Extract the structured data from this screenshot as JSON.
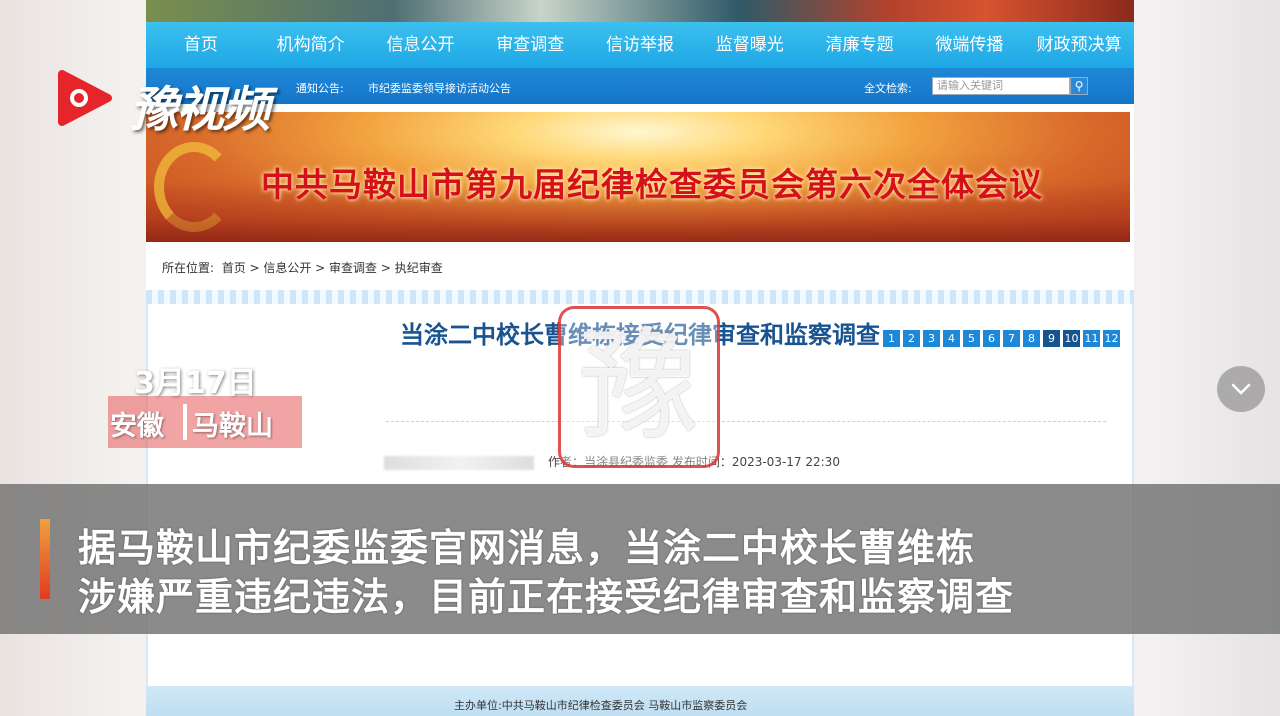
{
  "nav": {
    "items": [
      "首页",
      "机构简介",
      "信息公开",
      "审查调查",
      "信访举报",
      "监督曝光",
      "清廉专题",
      "微端传播",
      "财政预决算"
    ]
  },
  "notice": {
    "label": "通知公告:",
    "text": "市纪委监委领导接访活动公告",
    "search_label": "全文检索:",
    "search_placeholder": "请输入关键词"
  },
  "banner": {
    "title": "中共马鞍山市第九届纪律检查委员会第六次全体会议",
    "pages": [
      "1",
      "2",
      "3",
      "4",
      "5",
      "6",
      "7",
      "8",
      "9",
      "10",
      "11",
      "12"
    ]
  },
  "breadcrumb": {
    "label": "所在位置:",
    "path": "首页 > 信息公开 > 审查调查 > 执纪审查"
  },
  "article": {
    "title": "当涂二中校长曹维栋接受纪律审查和监察调查",
    "meta": "作者：当涂县纪委监委   发布时间：2023-03-17 22:30"
  },
  "footer": {
    "text": "主办单位:中共马鞍山市纪律检查委员会 马鞍山市监察委员会"
  },
  "overlay": {
    "logo_text": "豫视频",
    "date": "3月17日",
    "location_1": "安徽",
    "location_2": "马鞍山",
    "watermark_char": "豫",
    "subtitle_line_1": "据马鞍山市纪委监委官网消息，当涂二中校长曹维栋",
    "subtitle_line_2": "涉嫌严重违纪违法，目前正在接受纪律审查和监察调查"
  },
  "colors": {
    "nav": "#1ea7e6",
    "notice_bar": "#1575c8",
    "title_blue": "#1a5490",
    "banner_red": "#d4101a"
  }
}
